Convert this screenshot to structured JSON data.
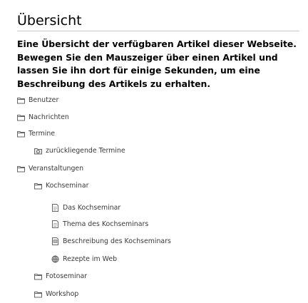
{
  "page": {
    "title": "Übersicht",
    "intro": "Eine Übersicht der verfügbaren Artikel dieser Webseite. Bewegen Sie den Mauszeiger über einen Artikel und lassen Sie ihn dort für einige Sekunden, um eine Beschreibung des Artikels zu erhalten."
  },
  "tree": [
    {
      "label": "Benutzer",
      "icon": "folder-icon"
    },
    {
      "label": "Nachrichten",
      "icon": "folder-icon"
    },
    {
      "label": "Termine",
      "icon": "folder-icon"
    },
    {
      "label": "zurückliegende Termine",
      "icon": "folder-smart-icon"
    },
    {
      "label": "Veranstaltungen",
      "icon": "folder-icon"
    },
    {
      "label": "Kochseminar",
      "icon": "folder-icon"
    },
    {
      "label": "Das Kochseminar",
      "icon": "document-icon"
    },
    {
      "label": "Thema des Kochseminars",
      "icon": "document-icon"
    },
    {
      "label": "Beschreibung des Kochseminars",
      "icon": "document-image-icon"
    },
    {
      "label": "Rezepte im Web",
      "icon": "link-globe-icon"
    },
    {
      "label": "Fotoseminar",
      "icon": "folder-icon"
    },
    {
      "label": "Workshop",
      "icon": "folder-icon"
    }
  ]
}
